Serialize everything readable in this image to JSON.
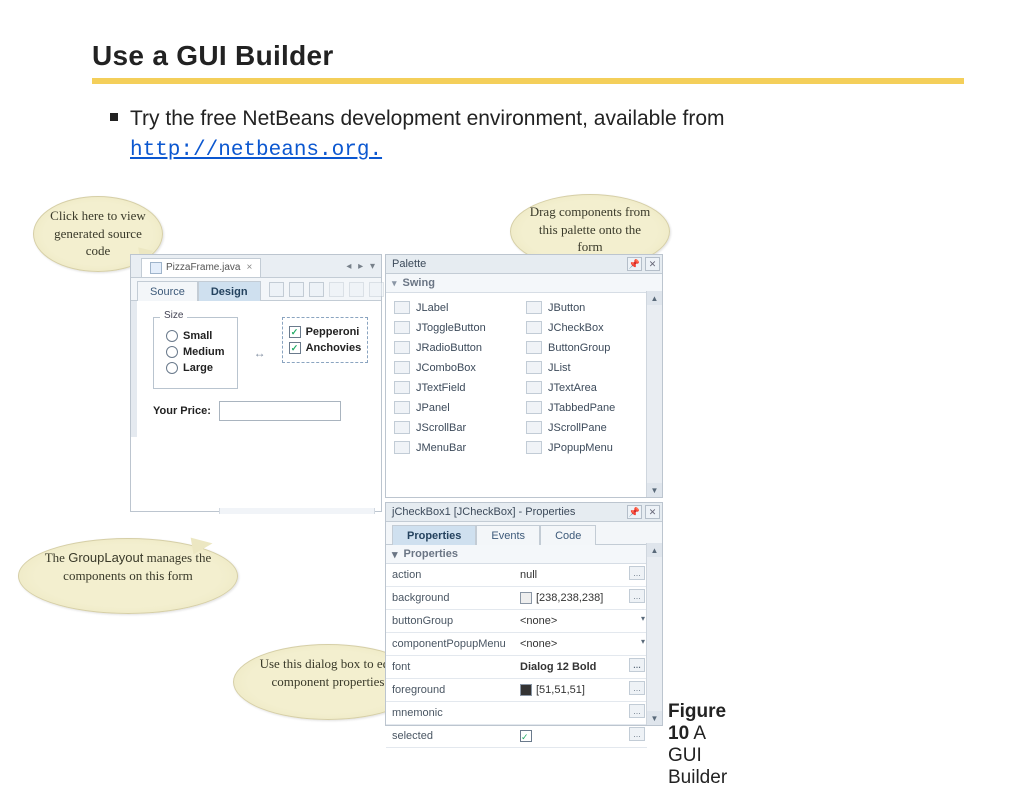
{
  "title": "Use a GUI Builder",
  "bullet": {
    "text": "Try the free NetBeans development environment, available from ",
    "link_text": "http://netbeans.org."
  },
  "callouts": {
    "c1": "Click here to view generated source code",
    "c2": "Drag components from this palette onto the form",
    "c3_pre": "The ",
    "c3_mono": "GroupLayout",
    "c3_post": " manages the components on this form",
    "c4": "Use this dialog box to edit component properties"
  },
  "editor": {
    "file_tab": "PizzaFrame.java",
    "file_tab_close": "×",
    "nav": "◂ ▸ ▾",
    "mode_source": "Source",
    "mode_design": "Design",
    "size_legend": "Size",
    "radios": [
      "Small",
      "Medium",
      "Large"
    ],
    "checks": [
      "Pepperoni",
      "Anchovies"
    ],
    "price_label": "Your Price:"
  },
  "palette": {
    "header": "Palette",
    "section": "Swing",
    "items_left": [
      "JLabel",
      "JToggleButton",
      "JRadioButton",
      "JComboBox",
      "JTextField",
      "JPanel",
      "JScrollBar",
      "JMenuBar"
    ],
    "items_right": [
      "JButton",
      "JCheckBox",
      "ButtonGroup",
      "JList",
      "JTextArea",
      "JTabbedPane",
      "JScrollPane",
      "JPopupMenu"
    ]
  },
  "props": {
    "header": "jCheckBox1 [JCheckBox] - Properties",
    "tab_properties": "Properties",
    "tab_events": "Events",
    "tab_code": "Code",
    "section": "Properties",
    "rows": [
      {
        "k": "action",
        "v": "null",
        "ctl": "dots"
      },
      {
        "k": "background",
        "v": "[238,238,238]",
        "ctl": "dots",
        "swatch": "bg"
      },
      {
        "k": "buttonGroup",
        "v": "<none>",
        "ctl": "chev"
      },
      {
        "k": "componentPopupMenu",
        "v": "<none>",
        "ctl": "chev"
      },
      {
        "k": "font",
        "v": "Dialog 12 Bold",
        "ctl": "dots",
        "bold": true
      },
      {
        "k": "foreground",
        "v": "[51,51,51]",
        "ctl": "dots",
        "swatch": "fg"
      },
      {
        "k": "mnemonic",
        "v": "",
        "ctl": "dots"
      },
      {
        "k": "selected",
        "v": "✓",
        "ctl": "dots",
        "isCheck": true
      }
    ]
  },
  "caption": {
    "label": "Figure 10",
    "text": " A GUI Builder"
  },
  "icons": {
    "pin": "📌",
    "close": "✕",
    "chev": "▾",
    "up": "▲",
    "down": "▼",
    "dots": "…"
  }
}
